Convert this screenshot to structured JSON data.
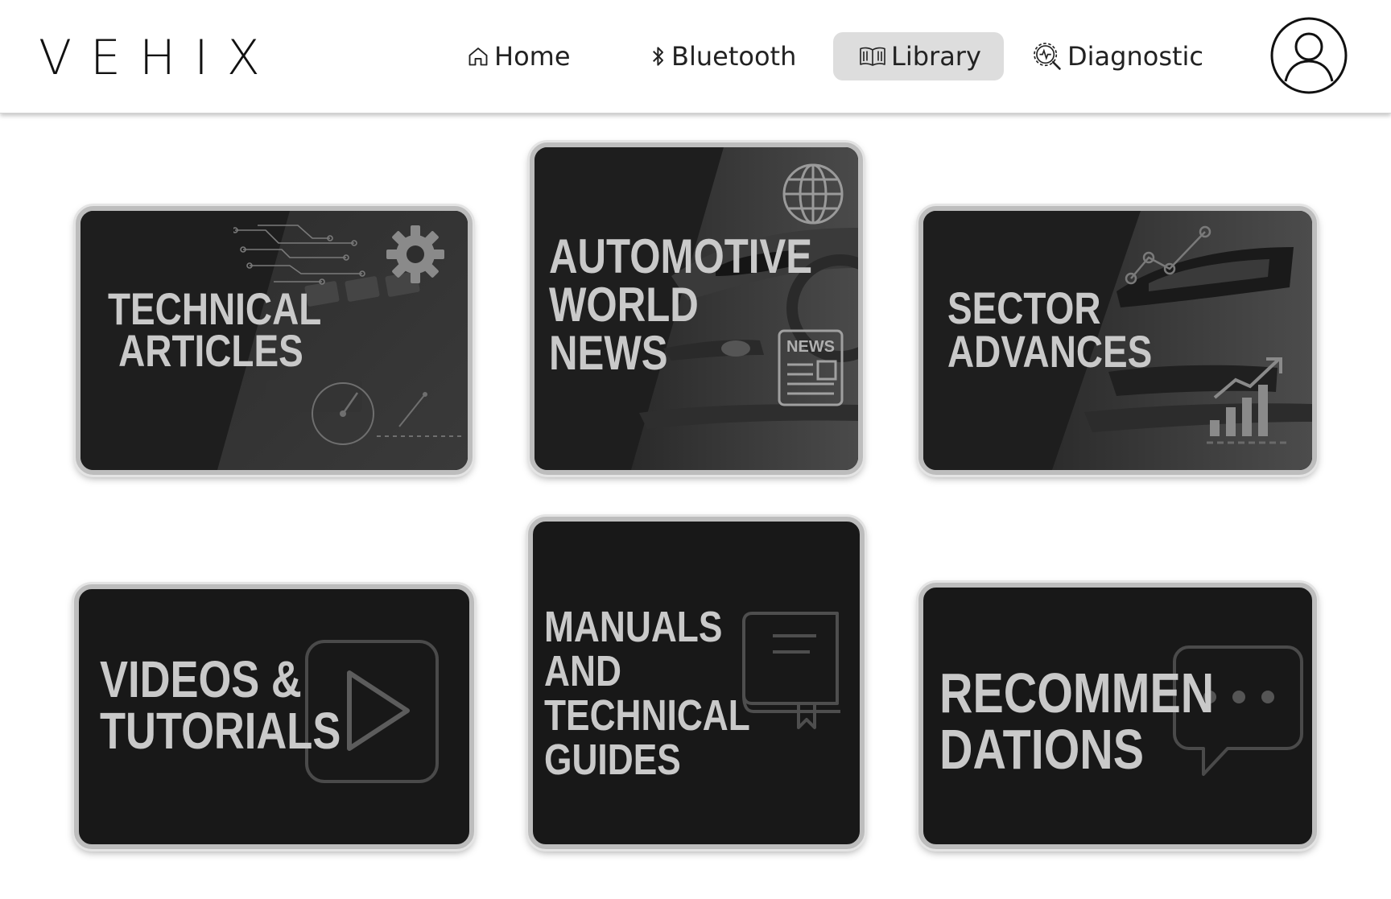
{
  "app": {
    "logo": "VEHIX"
  },
  "nav": {
    "items": [
      {
        "label": "Home",
        "icon": "home-icon",
        "active": false
      },
      {
        "label": "Bluetooth",
        "icon": "bluetooth-icon",
        "active": false
      },
      {
        "label": "Library",
        "icon": "book-open-icon",
        "active": true
      },
      {
        "label": "Diagnostic",
        "icon": "gear-search-icon",
        "active": false
      }
    ],
    "profile_icon": "user-profile-icon"
  },
  "cards": [
    {
      "lines": [
        "TECHNICAL",
        "ARTICLES"
      ],
      "icons": [
        "circuit-icon",
        "gear-icon",
        "speedometer-icon"
      ]
    },
    {
      "lines": [
        "AUTOMOTIVE",
        "WORLD",
        "NEWS"
      ],
      "icons": [
        "globe-icon",
        "newspaper-icon"
      ],
      "news_badge": "NEWS"
    },
    {
      "lines": [
        "SECTOR",
        "ADVANCES"
      ],
      "icons": [
        "trend-line-icon",
        "bar-chart-icon"
      ]
    },
    {
      "lines": [
        "VIDEOS &",
        "TUTORIALS"
      ],
      "icons": [
        "play-icon"
      ]
    },
    {
      "lines": [
        "MANUALS",
        "AND",
        "TECHNICAL",
        "GUIDES"
      ],
      "icons": [
        "book-icon"
      ]
    },
    {
      "lines": [
        "RECOMMEN",
        "DATIONS"
      ],
      "icons": [
        "chat-bubble-icon"
      ]
    }
  ],
  "colors": {
    "card_bg": "#1c1c1c",
    "card_text": "#c9c9c9",
    "nav_active_bg": "#dddddd",
    "card_border": "#bdbdbd"
  }
}
